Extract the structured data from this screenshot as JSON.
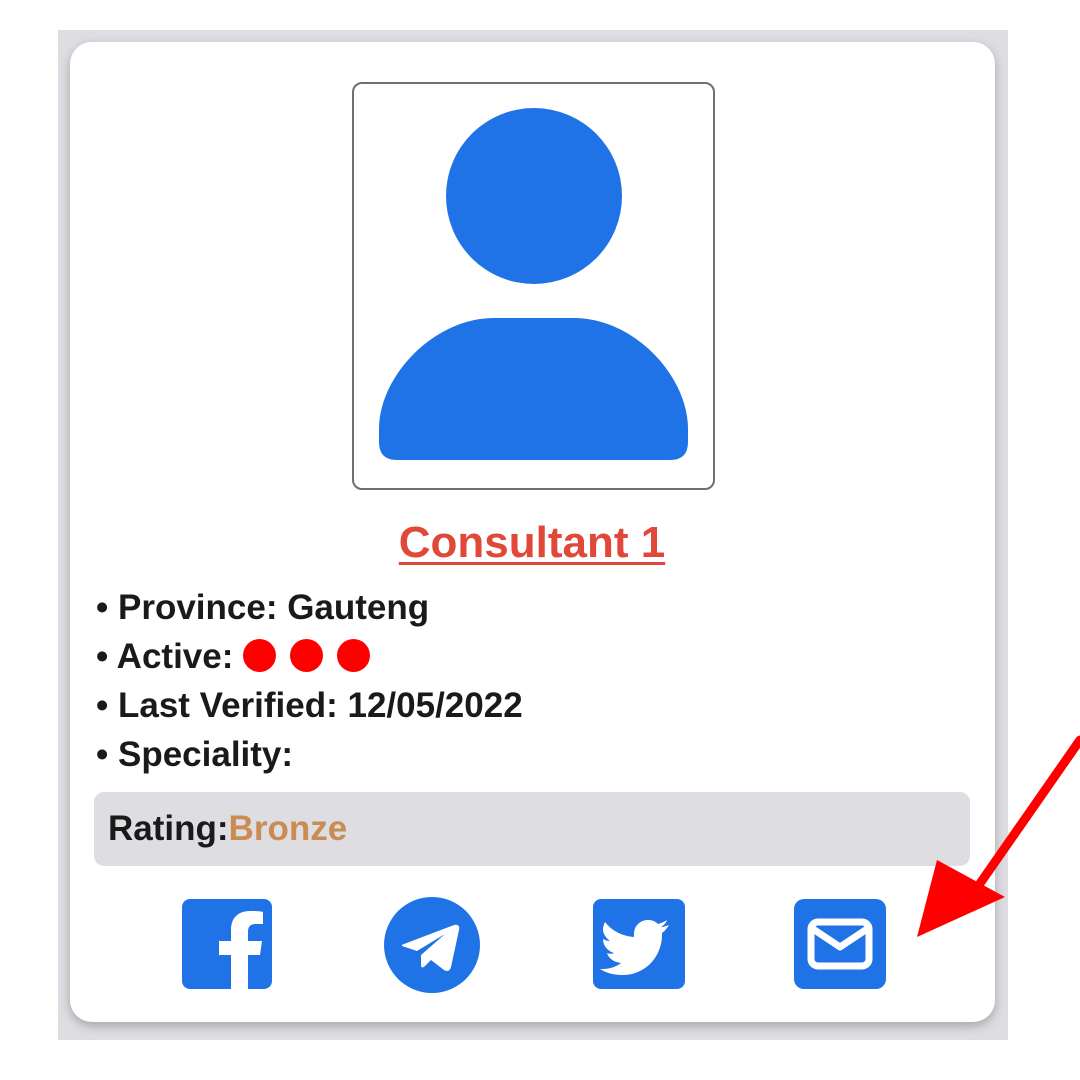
{
  "consultant": {
    "name": "Consultant 1",
    "details": [
      {
        "label": "• Province: ",
        "value": "Gauteng"
      },
      {
        "label": "• Active: ",
        "value": ""
      },
      {
        "label": "• Last Verified: ",
        "value": "12/05/2022"
      },
      {
        "label": "• Speciality:",
        "value": ""
      }
    ],
    "active_level": 3,
    "rating_label": "Rating:",
    "rating_value": "Bronze"
  },
  "social_links": [
    {
      "icon": "facebook-icon"
    },
    {
      "icon": "telegram-icon"
    },
    {
      "icon": "twitter-icon"
    },
    {
      "icon": "email-icon"
    }
  ],
  "colors": {
    "accent_blue": "#1f73e6",
    "name_red": "#e0483a",
    "active_dot_red": "#ff0000",
    "bronze": "#c98c52",
    "rating_bg": "#dedde2",
    "annotation_arrow": "#ff0000"
  }
}
